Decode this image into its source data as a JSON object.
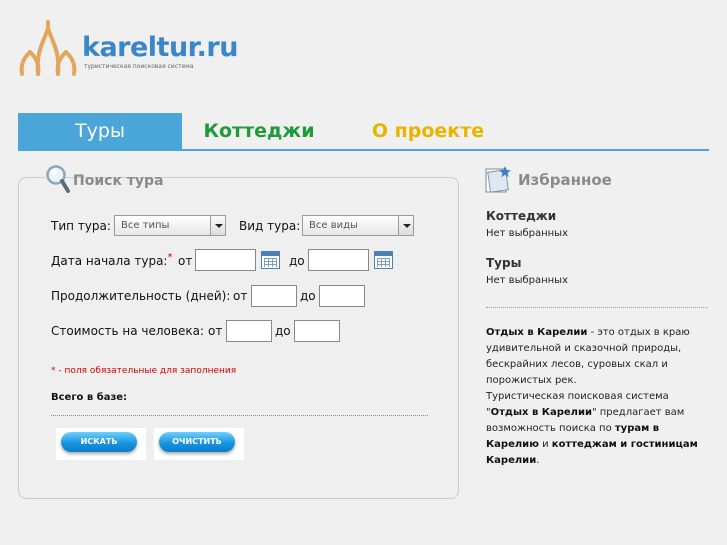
{
  "logo": {
    "name": "kareltur.ru",
    "subtitle": "туристическая поисковая система"
  },
  "nav": {
    "tabs": [
      {
        "label": "Туры",
        "active": true
      },
      {
        "label": "Коттеджи",
        "active": false
      },
      {
        "label": "О проекте",
        "active": false
      }
    ]
  },
  "search": {
    "title": "Поиск тура",
    "tour_type_label": "Тип тура:",
    "tour_type_value": "Все типы",
    "tour_kind_label": "Вид тура:",
    "tour_kind_value": "Все виды",
    "start_date_label": "Дата начала тура:",
    "required_mark": "*",
    "from_label": "от",
    "to_label": "до",
    "duration_label": "Продолжительность (дней):",
    "price_label": "Стоимость на человека:",
    "required_note": "* - поля обязательные для заполнения",
    "total_label": "Всего в базе:",
    "search_button": "ИСКАТЬ",
    "clear_button": "ОЧИСТИТЬ"
  },
  "favorites": {
    "title": "Избранное",
    "cottages_heading": "Коттеджи",
    "cottages_value": "Нет выбранных",
    "tours_heading": "Туры",
    "tours_value": "Нет выбранных",
    "about": {
      "p1_bold": "Отдых в Карелии",
      "p1_text": " - это отдых в краю удивительной и сказочной природы, бескрайних лесов, суровых скал и порожистых рек.",
      "p2_start": "Туристическая поисковая система \"",
      "p2_bold1": "Отдых в Карелии",
      "p2_mid1": "\" предлагает вам возможность поиска по ",
      "p2_bold2": "турам в Карелию",
      "p2_mid2": " и ",
      "p2_bold3": "коттеджам и гостиницам Карелии",
      "p2_end": "."
    }
  },
  "colors": {
    "accent": "#4aa6d9",
    "tab_cottages": "#1f9a3a",
    "tab_about": "#e8b400",
    "required": "#dd0000",
    "logo_text": "#3a86c8",
    "logo_mark": "#e2a55a"
  },
  "icons": {
    "logo": "church-domes-logo-icon",
    "search": "magnifier-icon",
    "favorites": "favorites-folder-icon",
    "date_picker": "calendar-icon"
  }
}
